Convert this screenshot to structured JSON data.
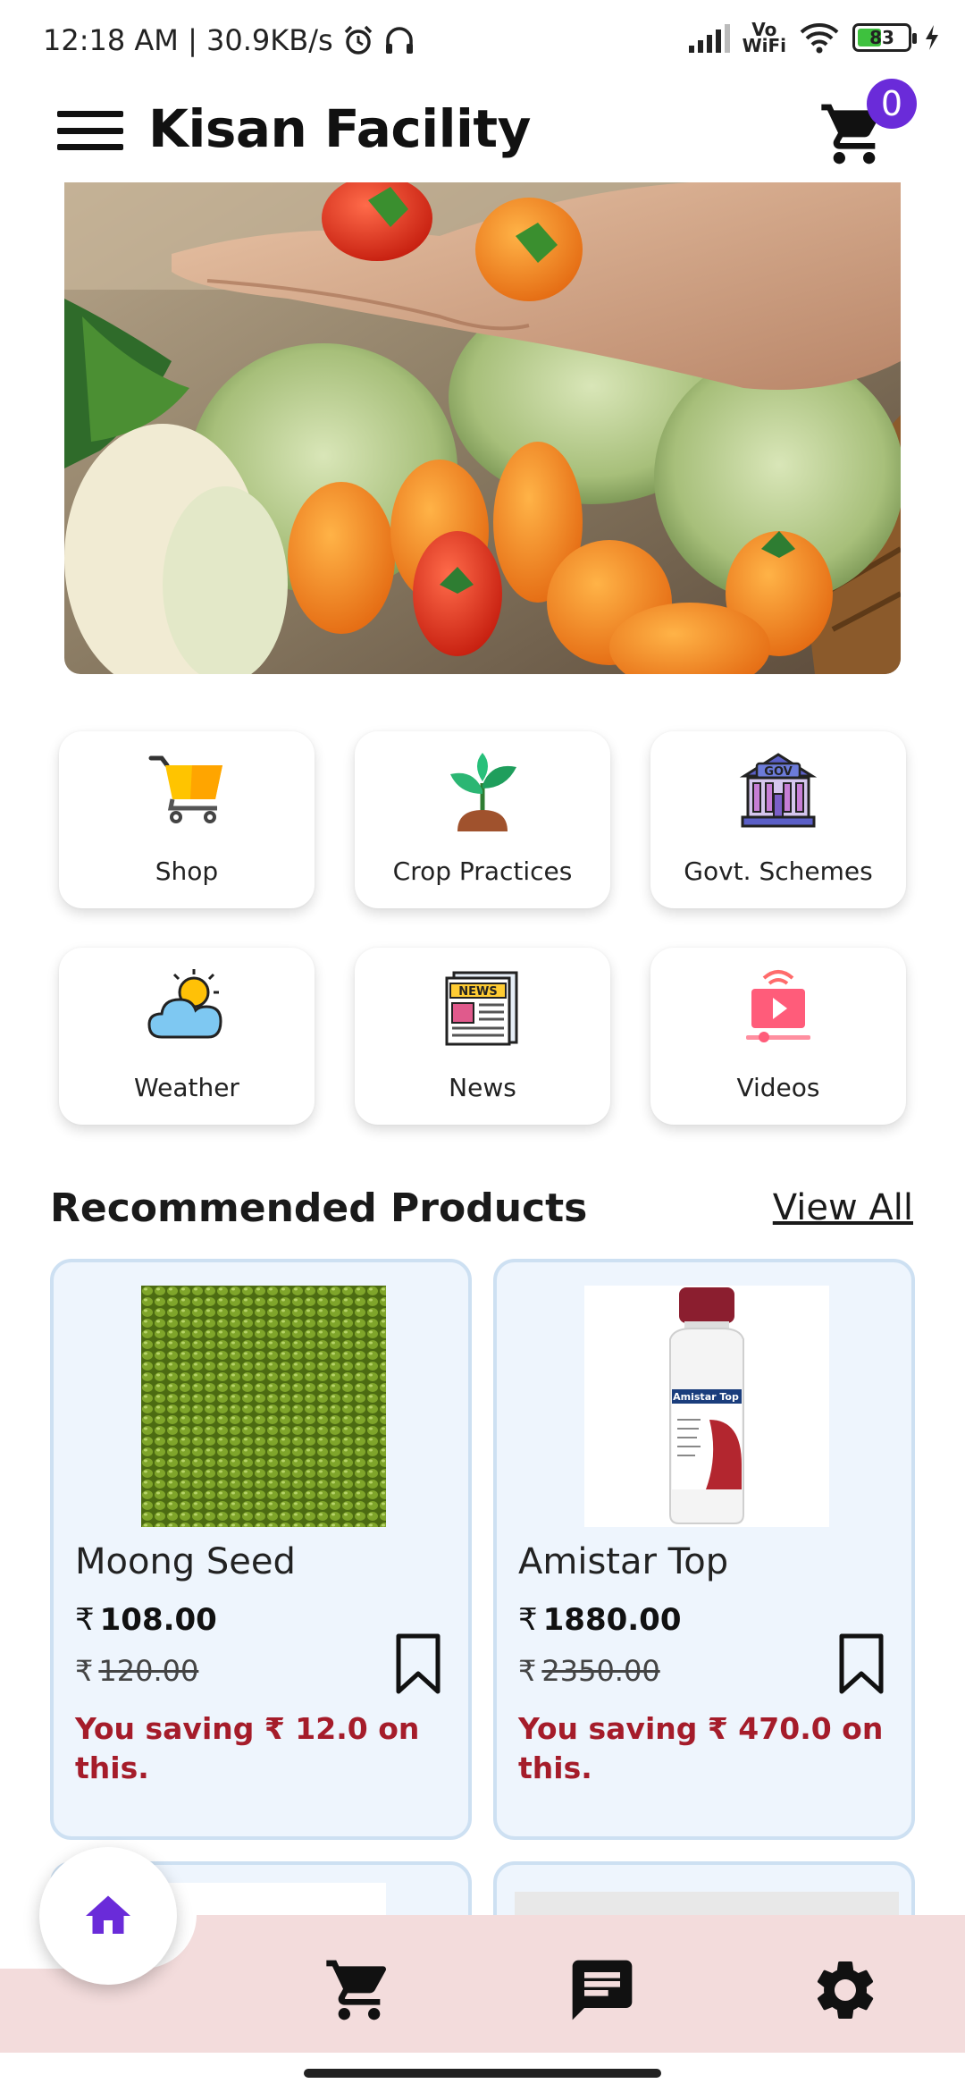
{
  "status_bar": {
    "time_text": "12:18 AM | 30.9KB/s",
    "volte_line1": "Vo",
    "volte_line2": "WiFi",
    "battery": "83"
  },
  "app_bar": {
    "title": "Kisan Facility",
    "cart_count": "0"
  },
  "tiles": [
    {
      "label": "Shop",
      "icon": "cart-icon"
    },
    {
      "label": "Crop Practices",
      "icon": "plant-icon"
    },
    {
      "label": "Govt. Schemes",
      "icon": "gov-building-icon"
    },
    {
      "label": "Weather",
      "icon": "weather-icon"
    },
    {
      "label": "News",
      "icon": "newspaper-icon"
    },
    {
      "label": "Videos",
      "icon": "video-icon"
    }
  ],
  "gov_icon_text": "GOV",
  "news_icon_text": "NEWS",
  "recommended": {
    "title": "Recommended Products",
    "view_all": "View All",
    "currency": "₹",
    "products": [
      {
        "name": "Moong Seed",
        "price": "108.00",
        "old_price": "120.00",
        "saving": "You saving ₹ 12.0 on this."
      },
      {
        "name": "Amistar Top",
        "price": "1880.00",
        "old_price": "2350.00",
        "saving": "You saving ₹ 470.0 on this."
      }
    ]
  },
  "bottle_label": "Amistar Top",
  "colors": {
    "accent": "#6a2bd9",
    "saving_red": "#a51c2a",
    "card_bg": "#eef5fd",
    "nav_bg": "#f3dcdc"
  }
}
